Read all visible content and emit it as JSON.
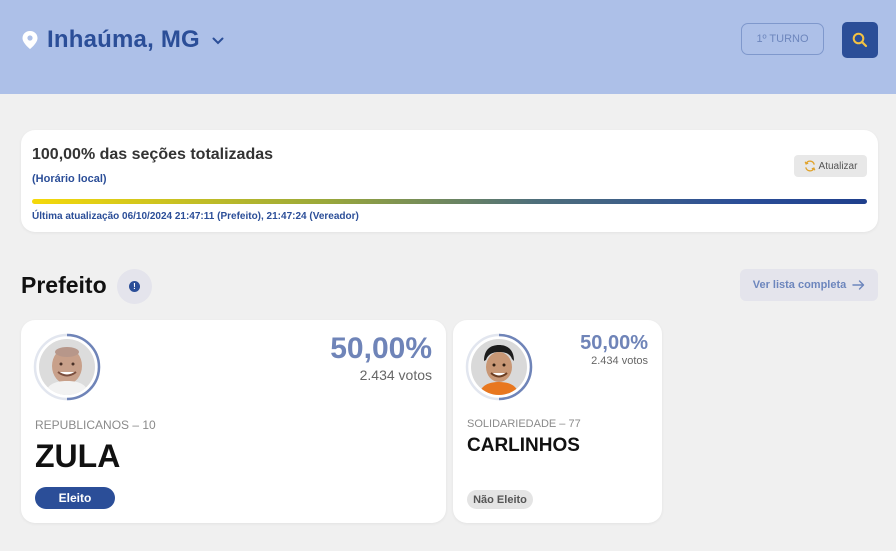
{
  "header": {
    "location": "Inhaúma, MG",
    "turno_label": "1º TURNO",
    "icons": {
      "location": "map-pin-icon",
      "dropdown": "chevron-down-icon",
      "search": "search-icon"
    },
    "colors": {
      "bar": "#adc0e8",
      "accent": "#2b4e98",
      "search_icon": "#f5c242"
    }
  },
  "status": {
    "title": "100,00% das seções totalizadas",
    "subtitle": "(Horário local)",
    "refresh_label": "Atualizar",
    "progress_fraction": 1.0,
    "last_update": "Última atualização 06/10/2024 21:47:11 (Prefeito), 21:47:24 (Vereador)"
  },
  "section": {
    "title": "Prefeito",
    "info_glyph": "!",
    "full_list_label": "Ver lista completa"
  },
  "candidates": [
    {
      "name": "ZULA",
      "party": "REPUBLICANOS – 10",
      "percent": "50,00%",
      "votes": "2.434 votos",
      "status": "Eleito",
      "vote_fraction": 0.5
    },
    {
      "name": "CARLINHOS",
      "party": "SOLIDARIEDADE – 77",
      "percent": "50,00%",
      "votes": "2.434 votos",
      "status": "Não Eleito",
      "vote_fraction": 0.5
    }
  ]
}
